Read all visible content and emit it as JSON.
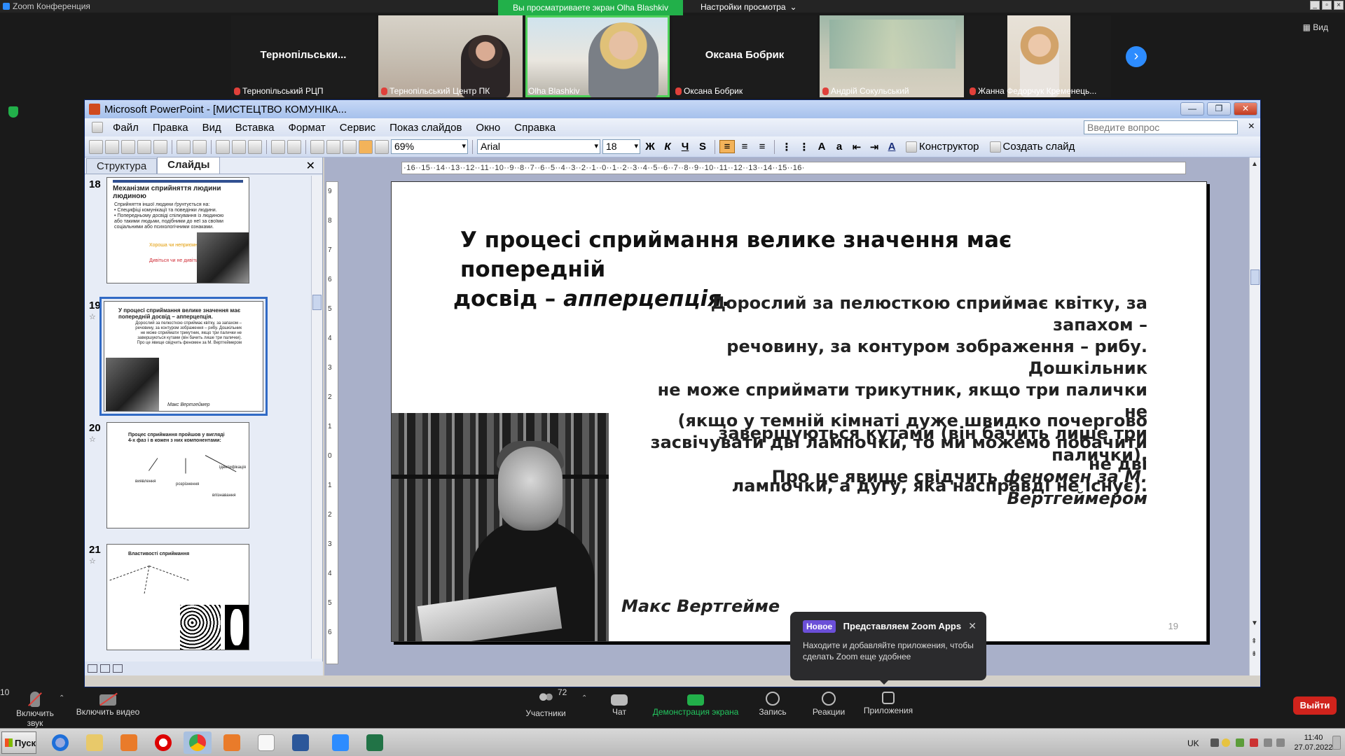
{
  "zoom": {
    "window_title": "Zoom Конференция",
    "share_banner": "Вы просматриваете экран Olha Blashkiv",
    "view_settings": "Настройки просмотра",
    "view_button": "Вид",
    "participants_strip": [
      {
        "big_name": "Тернопільськи...",
        "label": "Тернопільський РЦП",
        "video": false
      },
      {
        "big_name": "",
        "label": "Тернопільський Центр ПК",
        "video": true
      },
      {
        "big_name": "",
        "label": "Olha Blashkiv",
        "video": true,
        "active": true
      },
      {
        "big_name": "Оксана Бобрик",
        "label": "Оксана Бобрик",
        "video": false
      },
      {
        "big_name": "",
        "label": "Андрій Сокульський",
        "video": true
      },
      {
        "big_name": "",
        "label": "Жанна Федорчук Кременець...",
        "video": true
      }
    ],
    "popup": {
      "badge": "Новое",
      "title": "Представляем Zoom Apps",
      "body": "Находите и добавляйте приложения, чтобы сделать Zoom еще удобнее"
    },
    "controls": {
      "mute": "Включить звук",
      "video": "Включить видео",
      "participants": "Участники",
      "participants_count": "72",
      "chat": "Чат",
      "chat_badge": "10",
      "share": "Демонстрация экрана",
      "record": "Запись",
      "reactions": "Реакции",
      "apps": "Приложения",
      "leave": "Выйти"
    }
  },
  "ppt": {
    "title": "Microsoft PowerPoint - [МИСТЕЦТВО КОМУНІКА...",
    "menu": [
      "Файл",
      "Правка",
      "Вид",
      "Вставка",
      "Формат",
      "Сервис",
      "Показ слайдов",
      "Окно",
      "Справка"
    ],
    "ask_placeholder": "Введите вопрос",
    "zoom_level": "69%",
    "font_name": "Arial",
    "font_size": "18",
    "fmt_bold": "Ж",
    "fmt_italic": "К",
    "fmt_underline": "Ч",
    "fmt_shadow": "S",
    "designer_label": "Конструктор",
    "new_slide_label": "Создать слайд",
    "tabs": [
      "Структура",
      "Слайды"
    ],
    "ruler_h": "·16··15··14··13··12··11··10··9··8··7··6··5··4··3··2··1··0··1··2··3··4··5··6··7··8··9··10··11··12··13··14··15··16·",
    "thumbnails": [
      {
        "num": "18",
        "title": "Механізми сприйняття людини людиною",
        "text": [
          "Сприйняття іншої людини ґрунтується на:",
          "• Специфіці комунікації та поведінки людини.",
          "• Попередньому досвіді спілкування із людиною",
          "або такими людьми, подібними до неї за своїми",
          "соціальними або психологічними ознаками."
        ],
        "extra": [
          "Хороша чи неприємна",
          "Дивіться чи не дивіться"
        ]
      },
      {
        "num": "19",
        "title": "У процесі сприймання велике значення має попередній досвід – апперцепція.",
        "text": [
          "Дорослий за пелюсткою сприймає квітку, за запахом –",
          "речовину, за контуром зображення – рибу. Дошкільник",
          "не може сприймати трикутник, якщо три палички не",
          "завершуються кутами (він бачить лише три палички).",
          "Про це явище свідчить феномен за М. Вертгеймером"
        ],
        "caption": "Макс Вертгеймер"
      },
      {
        "num": "20",
        "title": "Процес сприймання пройшов у вигляді 4-х фаз і в кожен з них компонентами:",
        "text": [
          "виявлення",
          "розрізнення",
          "ідентифікація",
          "впізнавання"
        ]
      },
      {
        "num": "21",
        "title": "Властивості сприймання",
        "text": []
      }
    ],
    "slide": {
      "title_line1": "У процесі сприймання велике значення має попередній",
      "title_line2_plain": "досвід – ",
      "title_line2_em": "апперцепція",
      "title_line2_end": ".",
      "body_lines": [
        "Дорослий за пелюсткою сприймає квітку, за запахом –",
        "речовину, за контуром  зображення –  рибу. Дошкільник",
        "не може сприймати трикутник, якщо три палички не",
        "завершуються кутами (він бачить лише три палички)."
      ],
      "body_last_plain": "Про це явище свідчить ",
      "body_last_em": "феномен за М. Вертгеймером",
      "body2_lines": [
        "(якщо у темній кімнаті дуже швидко почергово",
        "засвічувати дві лампочки, то ми можемо побачити не дві",
        "лампочки, а дугу, яка насправді не існує)."
      ],
      "caption": "Макс Вертгейме",
      "number": "19"
    }
  },
  "taskbar": {
    "start": "Пуск",
    "lang": "UK",
    "time": "11:40",
    "date": "27.07.2022"
  }
}
